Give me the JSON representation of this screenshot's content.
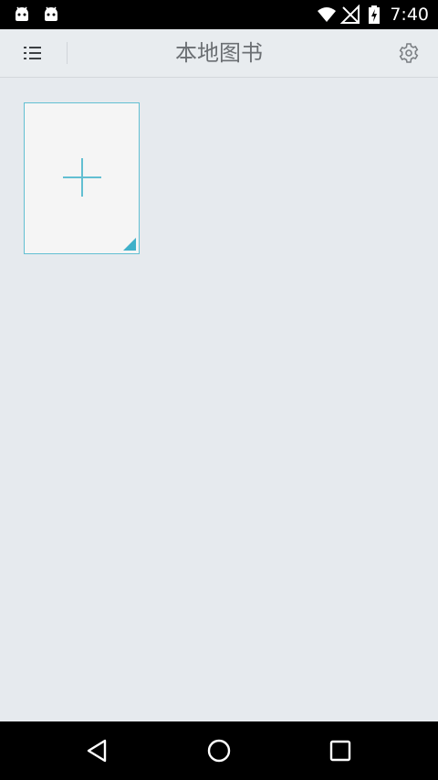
{
  "status_bar": {
    "time": "7:40",
    "icons": [
      "android-notification-icon",
      "android-notification-icon",
      "wifi-icon",
      "no-signal-icon",
      "battery-charging-icon"
    ]
  },
  "app_bar": {
    "title": "本地图书",
    "menu_icon": "list-menu-icon",
    "settings_icon": "gear-icon"
  },
  "library": {
    "add_tile_icon": "plus-icon"
  },
  "nav_bar": {
    "icons": [
      "back-triangle-icon",
      "home-circle-icon",
      "recents-square-icon"
    ]
  },
  "colors": {
    "background": "#e6eaee",
    "accent": "#62bfd2",
    "title_text": "#6b6f73"
  }
}
